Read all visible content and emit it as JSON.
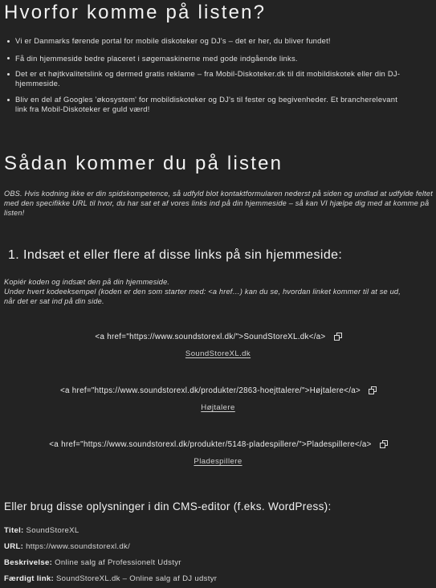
{
  "section1": {
    "title": "Hvorfor komme på listen?",
    "bullets": [
      "Vi er Danmarks førende portal for mobile diskoteker og DJ's – det er her, du bliver fundet!",
      "Få din hjemmeside bedre placeret i søgemaskinerne med gode indgående links.",
      "Det er et højtkvalitetslink og dermed gratis reklame – fra Mobil-Diskoteker.dk til dit mobildiskotek eller din DJ-hjemmeside.",
      "Bliv en del af Googles 'økosystem' for mobildiskoteker og DJ's til fester og begivenheder. Et brancherelevant link fra Mobil-Diskoteker er guld værd!"
    ]
  },
  "section2": {
    "title": "Sådan kommer du på listen",
    "note": "OBS. Hvis kodning ikke er din spidskompetence, så udfyld blot kontaktformularen nederst på siden og undlad at udfylde feltet med den specifikke URL til hvor, du har sat et af vores links ind på din hjemmeside – så kan VI hjælpe dig med at komme på listen!"
  },
  "step1": {
    "title": "1. Indsæt et eller flere af disse links på sin hjemmeside:",
    "instruction_line1": "Kopiér koden og indsæt den på din hjemmeside.",
    "instruction_line2": "Under hvert kodeeksempel (koden er den som starter med: <a href…) kan du se, hvordan linket kommer til at se ud, når det er sat ind på din side.",
    "links": [
      {
        "code": "<a href=\"https://www.soundstorexl.dk/\">SoundStoreXL.dk</a>",
        "preview": "SoundStoreXL.dk",
        "icon": "copy-icon"
      },
      {
        "code": "<a href=\"https://www.soundstorexl.dk/produkter/2863-hoejttalere/\">Højtalere</a>",
        "preview": "Højtalere",
        "icon": "copy-icon"
      },
      {
        "code": "<a href=\"https://www.soundstorexl.dk/produkter/5148-pladespillere/\">Pladespillere</a>",
        "preview": "Pladespillere",
        "icon": "copy-icon"
      }
    ]
  },
  "cms": {
    "title": "Eller brug disse oplysninger i din CMS-editor (f.eks. WordPress):",
    "rows": [
      {
        "label": "Titel:",
        "value": "SoundStoreXL"
      },
      {
        "label": "URL:",
        "value": "https://www.soundstorexl.dk/"
      },
      {
        "label": "Beskrivelse:",
        "value": "Online salg af Professionelt Udstyr"
      },
      {
        "label": "Færdigt link:",
        "value": "SoundStoreXL.dk – Online salg af DJ udstyr"
      }
    ]
  }
}
